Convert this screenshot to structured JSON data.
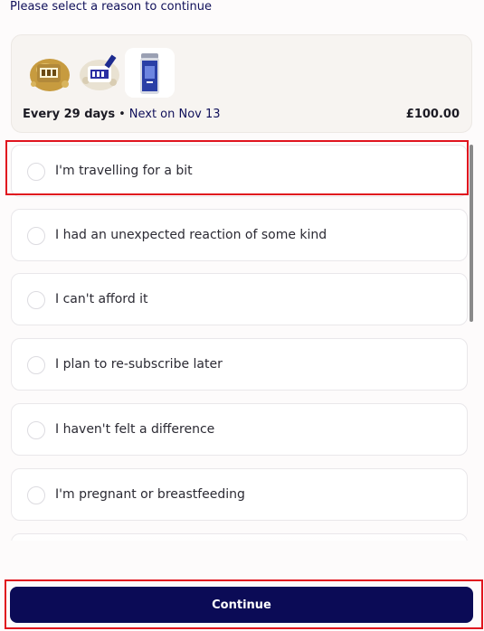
{
  "prompt": "Please select a reason to continue",
  "subscription": {
    "products": [
      {
        "icon": "product-pouch-gold-icon"
      },
      {
        "icon": "product-pouch-white-icon"
      },
      {
        "icon": "product-bottle-blue-icon"
      }
    ],
    "frequency": "Every 29 days",
    "separator": "•",
    "next": "Next on Nov 13",
    "price": "£100.00"
  },
  "reasons": [
    {
      "label": "I'm travelling for a bit",
      "selected": false
    },
    {
      "label": "I had an unexpected reaction of some kind",
      "selected": false
    },
    {
      "label": "I can't afford it",
      "selected": false
    },
    {
      "label": "I plan to re-subscribe later",
      "selected": false
    },
    {
      "label": "I haven't felt a difference",
      "selected": false
    },
    {
      "label": "I'm pregnant or breastfeeding",
      "selected": false
    }
  ],
  "continue_label": "Continue",
  "colors": {
    "primary": "#0b0b56",
    "highlight": "#e0141e",
    "card_bg": "#f7f4f1"
  }
}
